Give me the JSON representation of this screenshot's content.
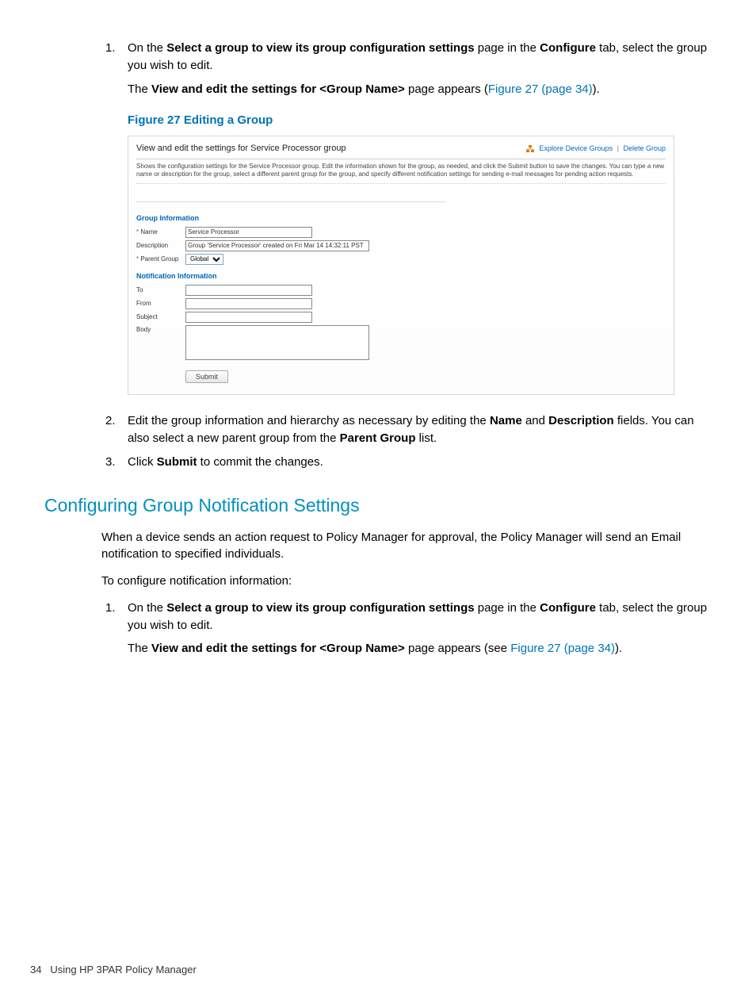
{
  "steps_a": {
    "n1": "1.",
    "p1_pre": "On the ",
    "p1_b1": "Select a group to view its group configuration settings",
    "p1_mid": " page in the ",
    "p1_b2": "Configure",
    "p1_post": " tab, select the group you wish to edit.",
    "p1b_pre": "The ",
    "p1b_b": "View and edit the settings for <Group Name>",
    "p1b_mid": " page appears (",
    "p1b_link": "Figure 27 (page 34)",
    "p1b_post": ")."
  },
  "figure": {
    "caption": "Figure 27 Editing a Group",
    "title": "View and edit the settings for Service Processor group",
    "link_explore": "Explore Device Groups",
    "link_delete": "Delete Group",
    "desc": "Shows the configuration settings for the Service Processor group. Edit the information shown for the group, as needed, and click the Submit button to save the changes. You can type a new name or description for the group, select a different parent group for the group, and specify different notification settings for sending e-mail messages for pending action requests.",
    "section_group": "Group Information",
    "label_name": "Name",
    "value_name": "Service Processor",
    "label_desc": "Description",
    "value_desc": "Group 'Service Processor' created on Fri Mar 14 14:32:11 PST",
    "label_parent": "Parent Group",
    "value_parent": "Global",
    "section_notif": "Notification Information",
    "label_to": "To",
    "label_from": "From",
    "label_subject": "Subject",
    "label_body": "Body",
    "submit": "Submit"
  },
  "steps_b": {
    "n2": "2.",
    "p2_pre": "Edit the group information and hierarchy as necessary by editing the ",
    "p2_b1": "Name",
    "p2_and": " and ",
    "p2_b2": "Description",
    "p2_mid": " fields. You can also select a new parent group from the ",
    "p2_b3": "Parent Group",
    "p2_post": " list.",
    "n3": "3.",
    "p3_pre": "Click ",
    "p3_b": "Submit",
    "p3_post": " to commit the changes."
  },
  "section2": {
    "heading": "Configuring Group Notification Settings",
    "para1": "When a device sends an action request to Policy Manager for approval, the Policy Manager will send an Email notification to specified individuals.",
    "para2": "To configure notification information:",
    "n1": "1.",
    "p1_pre": "On the ",
    "p1_b1": "Select a group to view its group configuration settings",
    "p1_mid": " page in the ",
    "p1_b2": "Configure",
    "p1_post": " tab, select the group you wish to edit.",
    "p1b_pre": "The ",
    "p1b_b": "View and edit the settings for <Group Name>",
    "p1b_mid": " page appears (see ",
    "p1b_link": "Figure 27 (page 34)",
    "p1b_post": ")."
  },
  "footer": {
    "pageno": "34",
    "text": "Using HP 3PAR Policy Manager"
  }
}
